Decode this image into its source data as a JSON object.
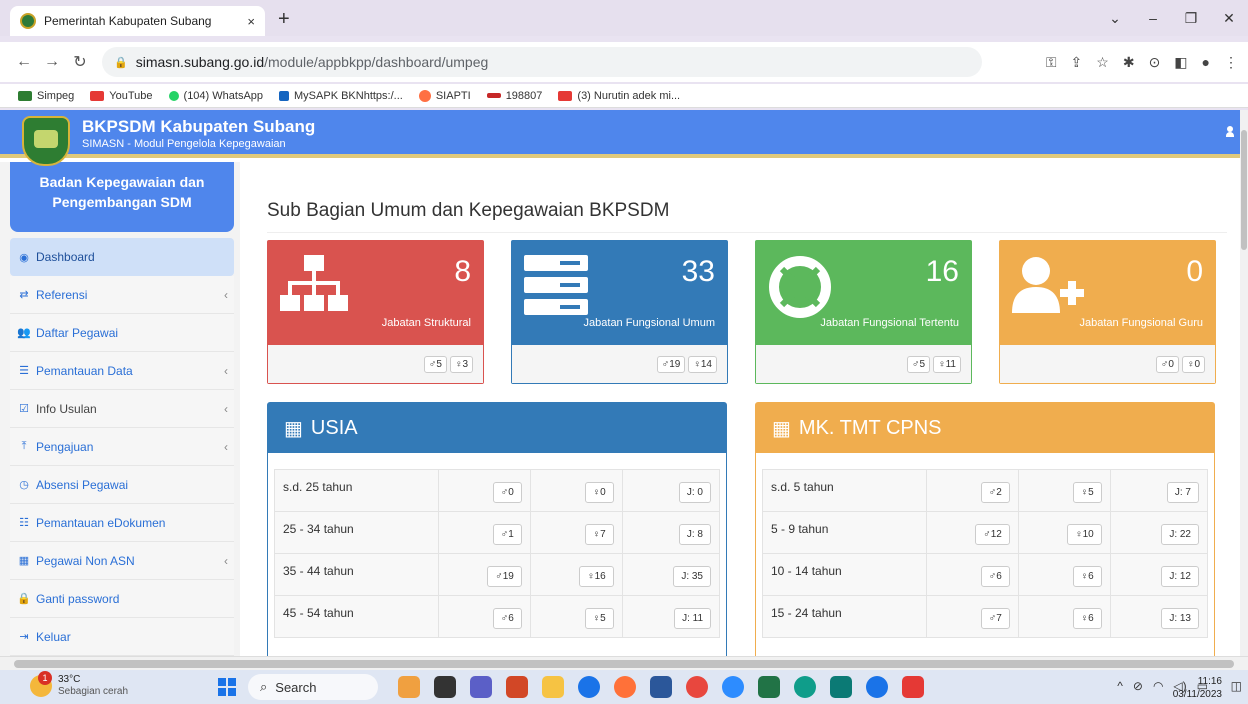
{
  "browser": {
    "tab_title": "Pemerintah Kabupaten Subang",
    "tab_close": "×",
    "new_tab": "+",
    "url_host": "simasn.subang.go.id",
    "url_path": "/module/appbkpp/dashboard/umpeg",
    "bookmarks": [
      "Simpeg",
      "YouTube",
      "(104) WhatsApp",
      "MySAPK BKNhttps:/...",
      "SIAPTI",
      "198807",
      "(3) Nurutin adek mi..."
    ]
  },
  "header": {
    "title": "BKPSDM Kabupaten Subang",
    "subtitle": "SIMASN - Modul Pengelola Kepegawaian"
  },
  "sidebar": {
    "heading_line1": "Badan Kepegawaian dan",
    "heading_line2": "Pengembangan SDM",
    "items": [
      {
        "label": "Dashboard",
        "icon": "dashboard-icon",
        "glyph": "◉"
      },
      {
        "label": "Referensi",
        "icon": "exchange-icon",
        "glyph": "⇄"
      },
      {
        "label": "Daftar Pegawai",
        "icon": "users-icon",
        "glyph": "👥"
      },
      {
        "label": "Pemantauan Data",
        "icon": "list-icon",
        "glyph": "☰"
      },
      {
        "label": "Info Usulan",
        "icon": "check-square-icon",
        "glyph": "☑"
      },
      {
        "label": "Pengajuan",
        "icon": "upload-icon",
        "glyph": "⤒"
      },
      {
        "label": "Absensi Pegawai",
        "icon": "clock-icon",
        "glyph": "◷"
      },
      {
        "label": "Pemantauan eDokumen",
        "icon": "list-alt-icon",
        "glyph": "☷"
      },
      {
        "label": "Pegawai Non ASN",
        "icon": "building-icon",
        "glyph": "▦"
      },
      {
        "label": "Ganti password",
        "icon": "lock-icon",
        "glyph": "🔒"
      },
      {
        "label": "Keluar",
        "icon": "sign-out-icon",
        "glyph": "⇥"
      }
    ]
  },
  "main": {
    "title": "Sub Bagian Umum dan Kepegawaian BKPSDM",
    "cards": [
      {
        "count": "8",
        "label": "Jabatan Struktural",
        "male": "♂5",
        "female": "♀3",
        "color": "#d9534f"
      },
      {
        "count": "33",
        "label": "Jabatan Fungsional Umum",
        "male": "♂19",
        "female": "♀14",
        "color": "#337ab7"
      },
      {
        "count": "16",
        "label": "Jabatan Fungsional Tertentu",
        "male": "♂5",
        "female": "♀11",
        "color": "#5cb85c"
      },
      {
        "count": "0",
        "label": "Jabatan Fungsional Guru",
        "male": "♂0",
        "female": "♀0",
        "color": "#f0ad4e"
      }
    ],
    "usia": {
      "title": "USIA",
      "rows": [
        {
          "range": "s.d. 25 tahun",
          "m": "♂0",
          "f": "♀0",
          "j": "J: 0"
        },
        {
          "range": "25 - 34 tahun",
          "m": "♂1",
          "f": "♀7",
          "j": "J: 8"
        },
        {
          "range": "35 - 44 tahun",
          "m": "♂19",
          "f": "♀16",
          "j": "J: 35"
        },
        {
          "range": "45 - 54 tahun",
          "m": "♂6",
          "f": "♀5",
          "j": "J: 11"
        }
      ]
    },
    "mk": {
      "title": "MK. TMT CPNS",
      "rows": [
        {
          "range": "s.d. 5 tahun",
          "m": "♂2",
          "f": "♀5",
          "j": "J: 7"
        },
        {
          "range": "5 - 9 tahun",
          "m": "♂12",
          "f": "♀10",
          "j": "J: 22"
        },
        {
          "range": "10 - 14 tahun",
          "m": "♂6",
          "f": "♀6",
          "j": "J: 12"
        },
        {
          "range": "15 - 24 tahun",
          "m": "♂7",
          "f": "♀6",
          "j": "J: 13"
        }
      ]
    }
  },
  "taskbar": {
    "temp": "33°C",
    "weather": "Sebagian cerah",
    "badge": "1",
    "search": "Search",
    "time": "11:16",
    "date": "03/11/2023"
  }
}
